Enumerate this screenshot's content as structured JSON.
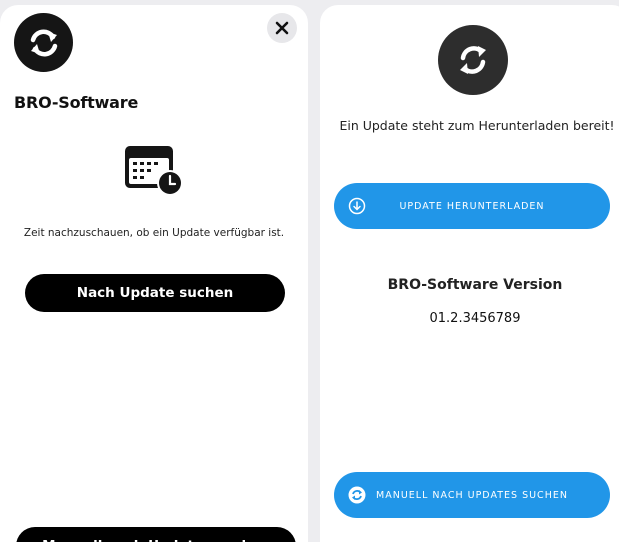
{
  "left_panel": {
    "app_title": "BRO-Software",
    "info_text": "Zeit nachzuschauen, ob ein Update verfügbar ist.",
    "search_button_label": "Nach Update suchen",
    "manual_button_label": "Manuell nach Updates suchen",
    "icons": {
      "logo": "sync-arrows-icon",
      "close": "close-icon",
      "illustration": "calendar-clock-icon"
    }
  },
  "right_panel": {
    "update_message": "Ein Update steht zum Herunterladen bereit!",
    "download_button_label": "UPDATE HERUNTERLADEN",
    "version_label": "BRO-Software Version",
    "version_number": "01.2.3456789",
    "manual_button_label": "MANUELL NACH UPDATES SUCHEN",
    "icons": {
      "logo": "sync-icon",
      "download": "download-icon",
      "manual": "refresh-icon"
    }
  },
  "colors": {
    "background": "#ededf0",
    "panel": "#ffffff",
    "primary_black": "#000000",
    "accent_blue": "#2196e8",
    "close_bg": "#e7e7ea"
  }
}
